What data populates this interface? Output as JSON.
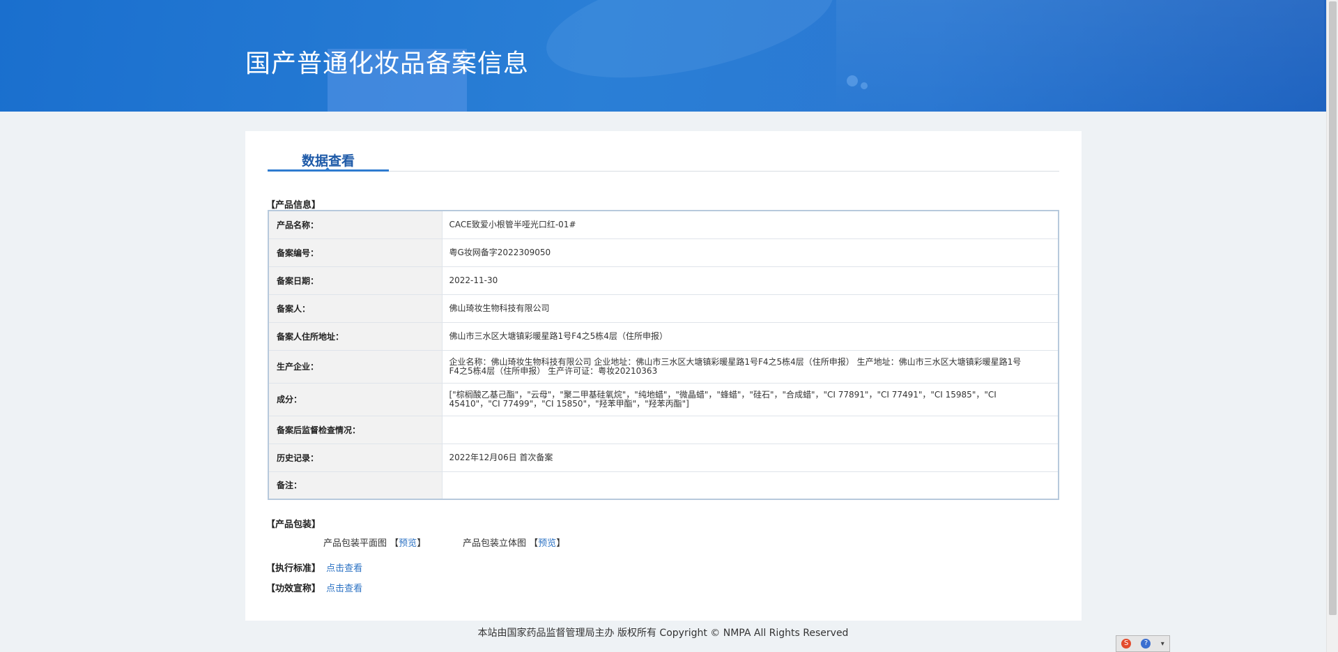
{
  "header": {
    "title": "国产普通化妆品备案信息"
  },
  "tabs": [
    {
      "label": "数据查看"
    }
  ],
  "sections": {
    "product_info": "【产品信息】",
    "product_package": "【产品包装】",
    "standard": "【执行标准】",
    "efficacy": "【功效宣称】"
  },
  "product_info": [
    {
      "label": "产品名称：",
      "value": "CACE致爱小根管半哑光口红-01#"
    },
    {
      "label": "备案编号：",
      "value": "粤G妆网备字2022309050"
    },
    {
      "label": "备案日期：",
      "value": "2022-11-30"
    },
    {
      "label": "备案人：",
      "value": "佛山琦妆生物科技有限公司"
    },
    {
      "label": "备案人住所地址：",
      "value": "佛山市三水区大塘镇彩暖星路1号F4之5栋4层（住所申报）"
    },
    {
      "label": "生产企业：",
      "value": "企业名称：佛山琦妆生物科技有限公司 企业地址：佛山市三水区大塘镇彩暖星路1号F4之5栋4层（住所申报） 生产地址：佛山市三水区大塘镇彩暖星路1号F4之5栋4层（住所申报） 生产许可证：粤妆20210363"
    },
    {
      "label": "成分：",
      "value": "[\"棕榈酸乙基己酯\"，\"云母\"，\"聚二甲基硅氧烷\"，\"纯地蜡\"，\"微晶蜡\"，\"蜂蜡\"，\"硅石\"，\"合成蜡\"，\"CI 77891\"，\"CI 77491\"，\"CI 15985\"，\"CI 45410\"，\"CI 77499\"，\"CI 15850\"，\"羟苯甲酯\"，\"羟苯丙酯\"]"
    },
    {
      "label": "备案后监督检查情况：",
      "value": ""
    },
    {
      "label": "历史记录：",
      "value": "2022年12月06日 首次备案"
    },
    {
      "label": "备注：",
      "value": ""
    }
  ],
  "package": {
    "flat_label": "产品包装平面图",
    "flat_link": "预览",
    "solid_label": "产品包装立体图",
    "solid_link": "预览",
    "bracket_open": "【",
    "bracket_close": "】"
  },
  "standard_link": "点击查看",
  "efficacy_link": "点击查看",
  "footer": {
    "text": "本站由国家药品监督管理局主办 版权所有 Copyright © NMPA All Rights Reserved"
  },
  "colors": {
    "banner": "#2a7fd6",
    "tab_accent": "#1e5aa8",
    "link": "#2d73c4"
  }
}
